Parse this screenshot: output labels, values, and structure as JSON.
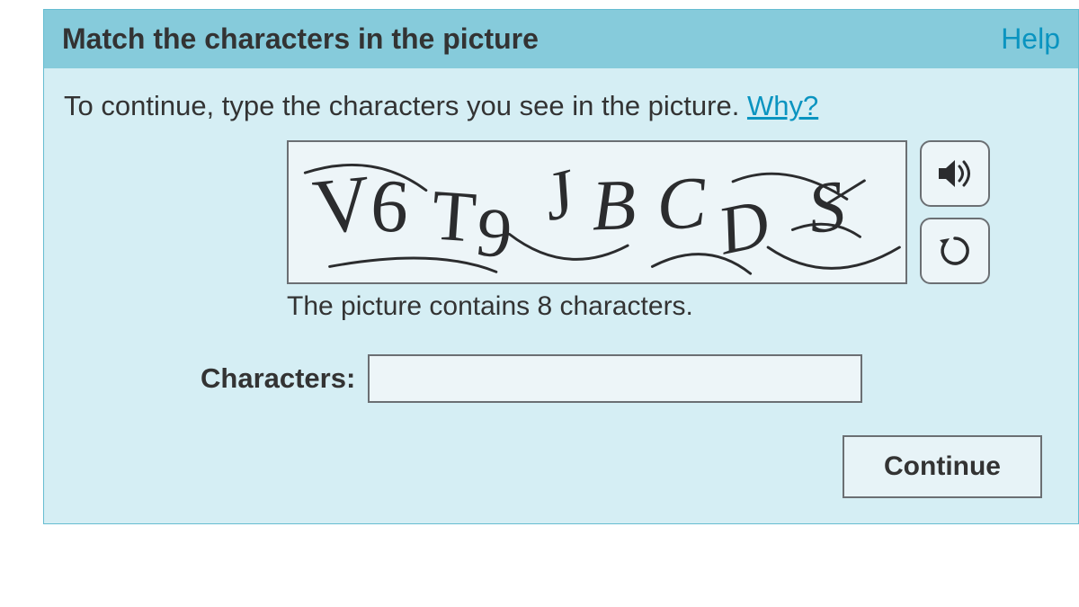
{
  "header": {
    "title": "Match the characters in the picture",
    "help_link": "Help"
  },
  "instruction": {
    "text": "To continue, type the characters you see in the picture. ",
    "why_link": "Why?"
  },
  "captcha": {
    "characters": "V6T9JBCDS",
    "count_text": "The picture contains 8 characters."
  },
  "controls": {
    "audio_tooltip": "Play audio challenge",
    "refresh_tooltip": "Get a new challenge"
  },
  "input": {
    "label": "Characters:",
    "value": ""
  },
  "actions": {
    "continue_label": "Continue"
  }
}
